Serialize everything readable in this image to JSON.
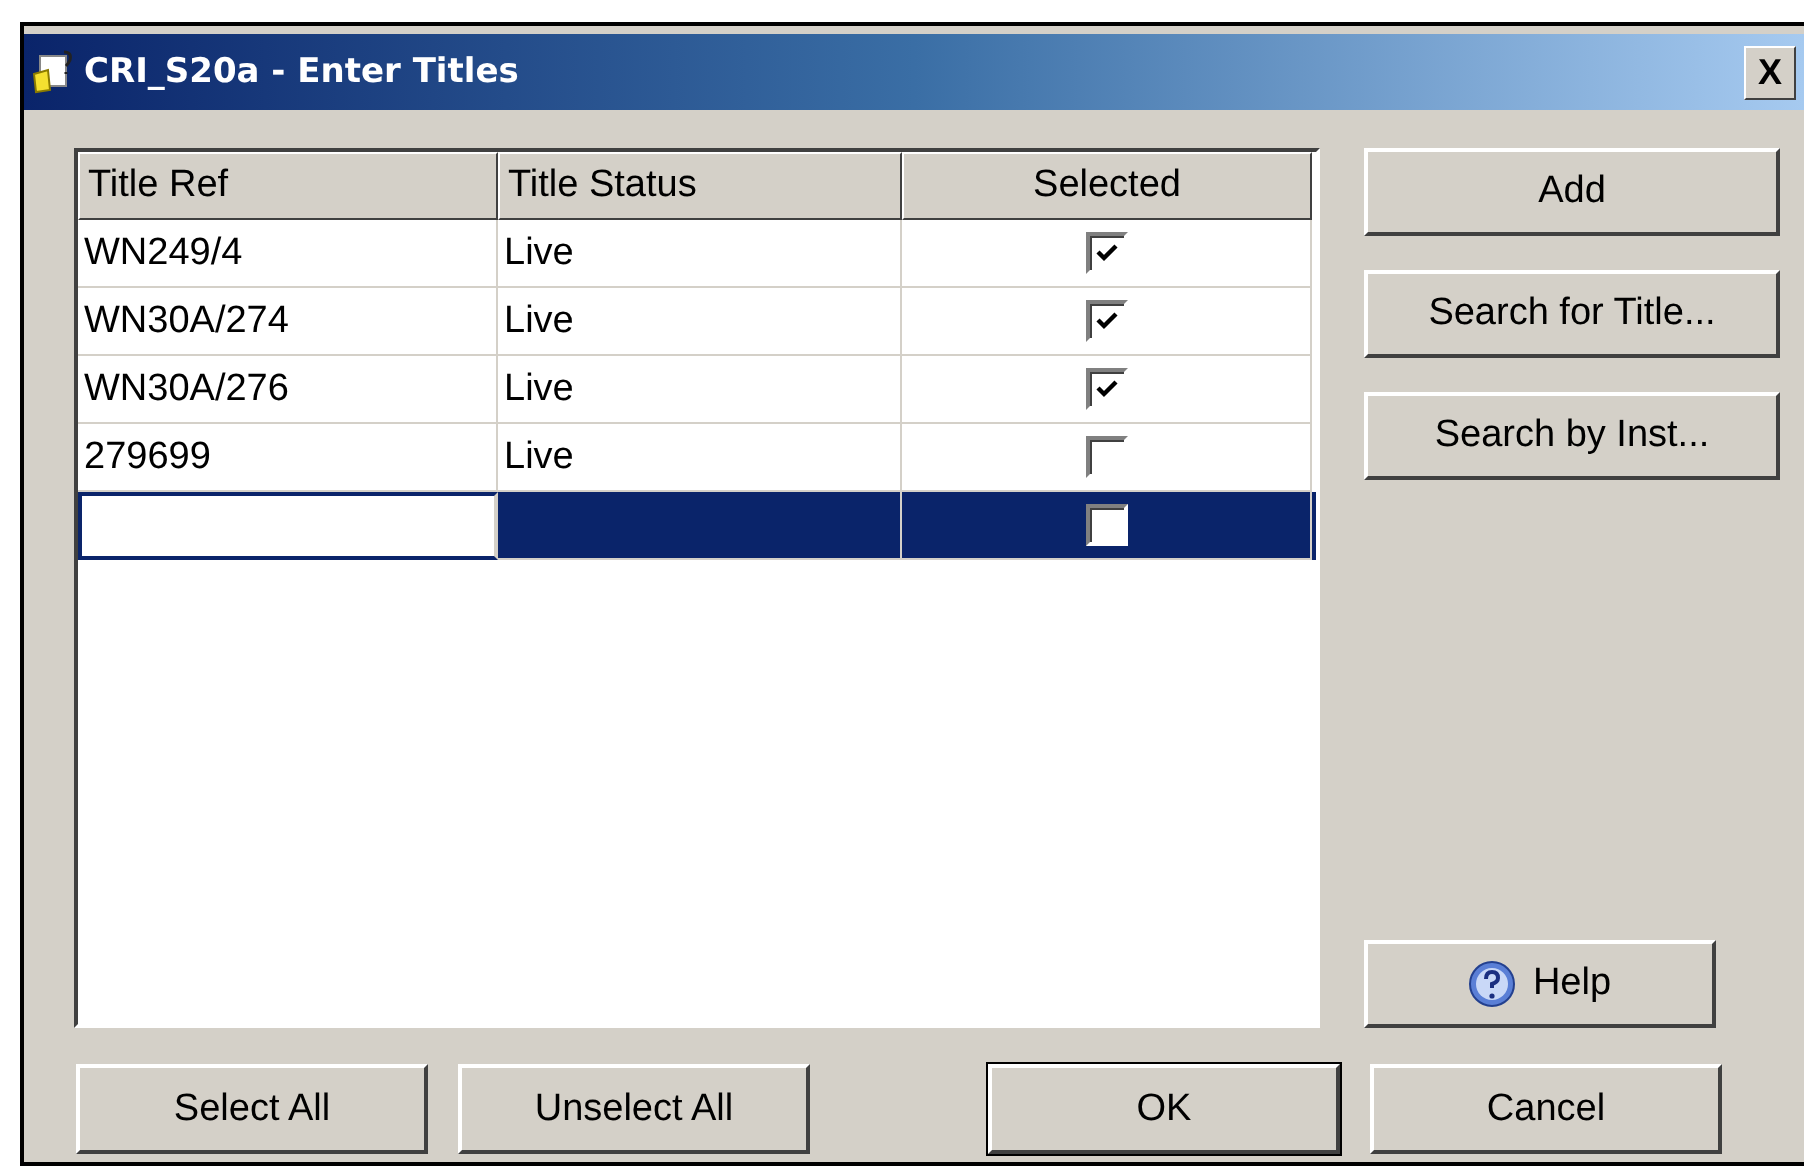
{
  "window": {
    "title": "CRI_S20a - Enter Titles",
    "close": "X"
  },
  "table": {
    "columns": [
      "Title Ref",
      "Title Status",
      "Selected"
    ],
    "rows": [
      {
        "title_ref": "WN249/4",
        "status": "Live",
        "checked": true,
        "selected": false
      },
      {
        "title_ref": "WN30A/274",
        "status": "Live",
        "checked": true,
        "selected": false
      },
      {
        "title_ref": "WN30A/276",
        "status": "Live",
        "checked": true,
        "selected": false
      },
      {
        "title_ref": "279699",
        "status": "Live",
        "checked": false,
        "selected": false
      },
      {
        "checked": false,
        "selected": true
      }
    ]
  },
  "side_buttons": [
    "Add",
    "Search for Title...",
    "Search by Inst..."
  ],
  "help_button": "Help",
  "bottom_buttons": [
    {
      "label": "Select All",
      "kind": "plain"
    },
    {
      "label": "Unselect All",
      "kind": "plain"
    },
    {
      "label": "OK",
      "kind": "default"
    },
    {
      "label": "Cancel",
      "kind": "plain"
    }
  ]
}
